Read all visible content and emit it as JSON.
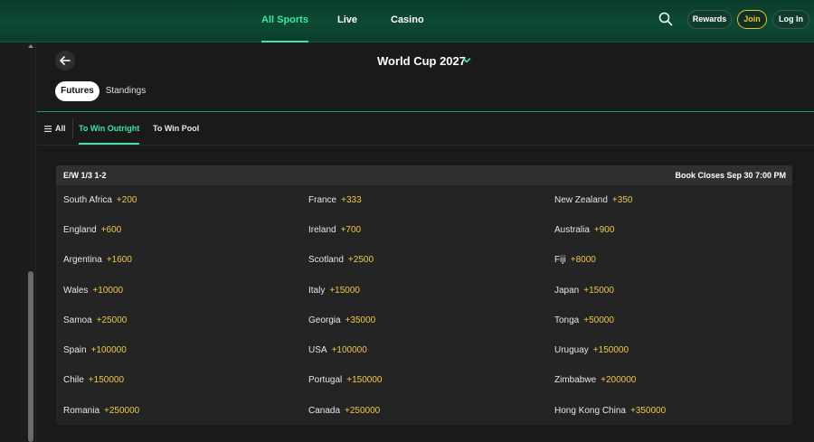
{
  "nav": {
    "tabs": [
      {
        "label": "All Sports",
        "active": true
      },
      {
        "label": "Live",
        "active": false
      },
      {
        "label": "Casino",
        "active": false
      }
    ],
    "rewards_label": "Rewards",
    "join_label": "Join",
    "login_label": "Log In"
  },
  "event": {
    "title": "World Cup 2027"
  },
  "segments": [
    {
      "label": "Futures",
      "active": true
    },
    {
      "label": "Standings",
      "active": false
    }
  ],
  "subnav": {
    "all_label": "All",
    "tabs": [
      {
        "label": "To Win Outright",
        "active": true
      },
      {
        "label": "To Win Pool",
        "active": false
      }
    ]
  },
  "market": {
    "each_way": "E/W 1/3 1-2",
    "book_closes": "Book Closes Sep 30 7:00 PM",
    "selections": [
      {
        "name": "South Africa",
        "price": "+200"
      },
      {
        "name": "France",
        "price": "+333"
      },
      {
        "name": "New Zealand",
        "price": "+350"
      },
      {
        "name": "England",
        "price": "+600"
      },
      {
        "name": "Ireland",
        "price": "+700"
      },
      {
        "name": "Australia",
        "price": "+900"
      },
      {
        "name": "Argentina",
        "price": "+1600"
      },
      {
        "name": "Scotland",
        "price": "+2500"
      },
      {
        "name": "Fiji",
        "price": "+8000"
      },
      {
        "name": "Wales",
        "price": "+10000"
      },
      {
        "name": "Italy",
        "price": "+15000"
      },
      {
        "name": "Japan",
        "price": "+15000"
      },
      {
        "name": "Samoa",
        "price": "+25000"
      },
      {
        "name": "Georgia",
        "price": "+35000"
      },
      {
        "name": "Tonga",
        "price": "+50000"
      },
      {
        "name": "Spain",
        "price": "+100000"
      },
      {
        "name": "USA",
        "price": "+100000"
      },
      {
        "name": "Uruguay",
        "price": "+150000"
      },
      {
        "name": "Chile",
        "price": "+150000"
      },
      {
        "name": "Portugal",
        "price": "+150000"
      },
      {
        "name": "Zimbabwe",
        "price": "+200000"
      },
      {
        "name": "Romania",
        "price": "+250000"
      },
      {
        "name": "Canada",
        "price": "+250000"
      },
      {
        "name": "Hong Kong China",
        "price": "+350000"
      }
    ]
  },
  "colors": {
    "accent": "#3ee6a0",
    "price": "#f0c84a",
    "join": "#e6c72e"
  }
}
